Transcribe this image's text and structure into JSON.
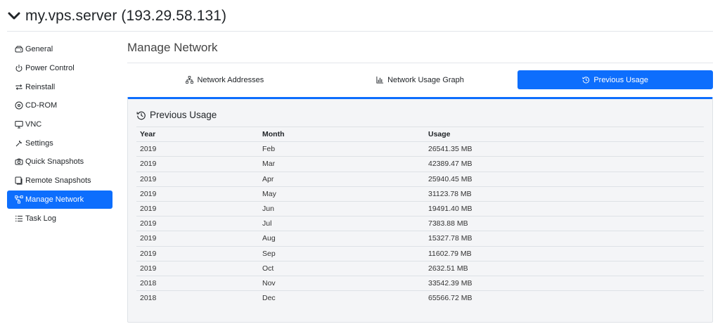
{
  "server": {
    "title": "my.vps.server (193.29.58.131)"
  },
  "sidebar": {
    "items": [
      {
        "label": "General",
        "icon": "hdd-icon"
      },
      {
        "label": "Power Control",
        "icon": "power-icon"
      },
      {
        "label": "Reinstall",
        "icon": "repeat-icon"
      },
      {
        "label": "CD-ROM",
        "icon": "disc-icon"
      },
      {
        "label": "VNC",
        "icon": "display-icon"
      },
      {
        "label": "Settings",
        "icon": "wrench-icon"
      },
      {
        "label": "Quick Snapshots",
        "icon": "camera-icon"
      },
      {
        "label": "Remote Snapshots",
        "icon": "copy-icon"
      },
      {
        "label": "Manage Network",
        "icon": "network-icon",
        "active": true
      },
      {
        "label": "Task Log",
        "icon": "list-icon"
      }
    ]
  },
  "main": {
    "title": "Manage Network",
    "tabs": [
      {
        "label": "Network Addresses",
        "icon": "diagram-icon"
      },
      {
        "label": "Network Usage Graph",
        "icon": "bar-chart-icon"
      },
      {
        "label": "Previous Usage",
        "icon": "history-icon",
        "active": true
      }
    ],
    "card_title": "Previous Usage",
    "table": {
      "headers": [
        "Year",
        "Month",
        "Usage"
      ],
      "rows": [
        [
          "2019",
          "Feb",
          "26541.35 MB"
        ],
        [
          "2019",
          "Mar",
          "42389.47 MB"
        ],
        [
          "2019",
          "Apr",
          "25940.45 MB"
        ],
        [
          "2019",
          "May",
          "31123.78 MB"
        ],
        [
          "2019",
          "Jun",
          "19491.40 MB"
        ],
        [
          "2019",
          "Jul",
          "7383.88 MB"
        ],
        [
          "2019",
          "Aug",
          "15327.78 MB"
        ],
        [
          "2019",
          "Sep",
          "11602.79 MB"
        ],
        [
          "2019",
          "Oct",
          "2632.51 MB"
        ],
        [
          "2018",
          "Nov",
          "33542.39 MB"
        ],
        [
          "2018",
          "Dec",
          "65566.72 MB"
        ]
      ]
    }
  },
  "colors": {
    "accent": "#0d6efd",
    "card_bg": "#f4f5f7"
  }
}
